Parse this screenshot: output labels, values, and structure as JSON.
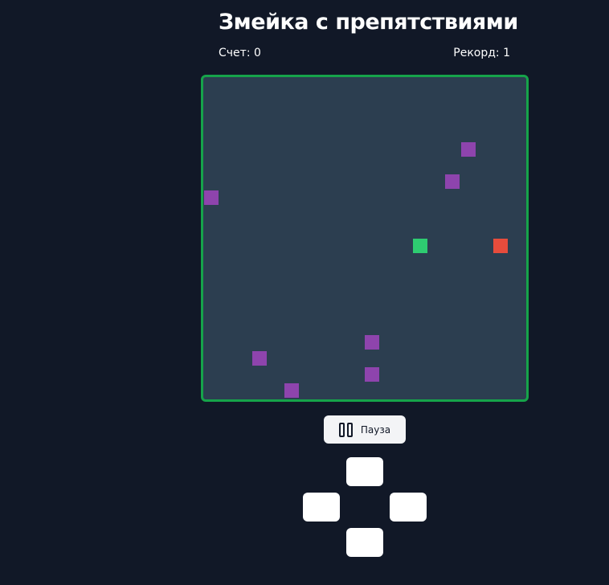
{
  "title": "Змейка с препятствиями",
  "score_label": "Счет: 0",
  "record_label": "Рекорд: 1",
  "pause_label": "Пауза",
  "colors": {
    "snake": "#2ecc71",
    "food": "#e74c3c",
    "obstacle": "#8e44ad",
    "border": "#16a34a",
    "board": "#2c3e50"
  },
  "grid": {
    "cols": 20,
    "rows": 20,
    "snake": [
      [
        13,
        10
      ]
    ],
    "food": [
      18,
      10
    ],
    "obstacles": [
      [
        16,
        4
      ],
      [
        15,
        6
      ],
      [
        0,
        7
      ],
      [
        10,
        16
      ],
      [
        3,
        17
      ],
      [
        10,
        18
      ],
      [
        5,
        19
      ]
    ]
  }
}
